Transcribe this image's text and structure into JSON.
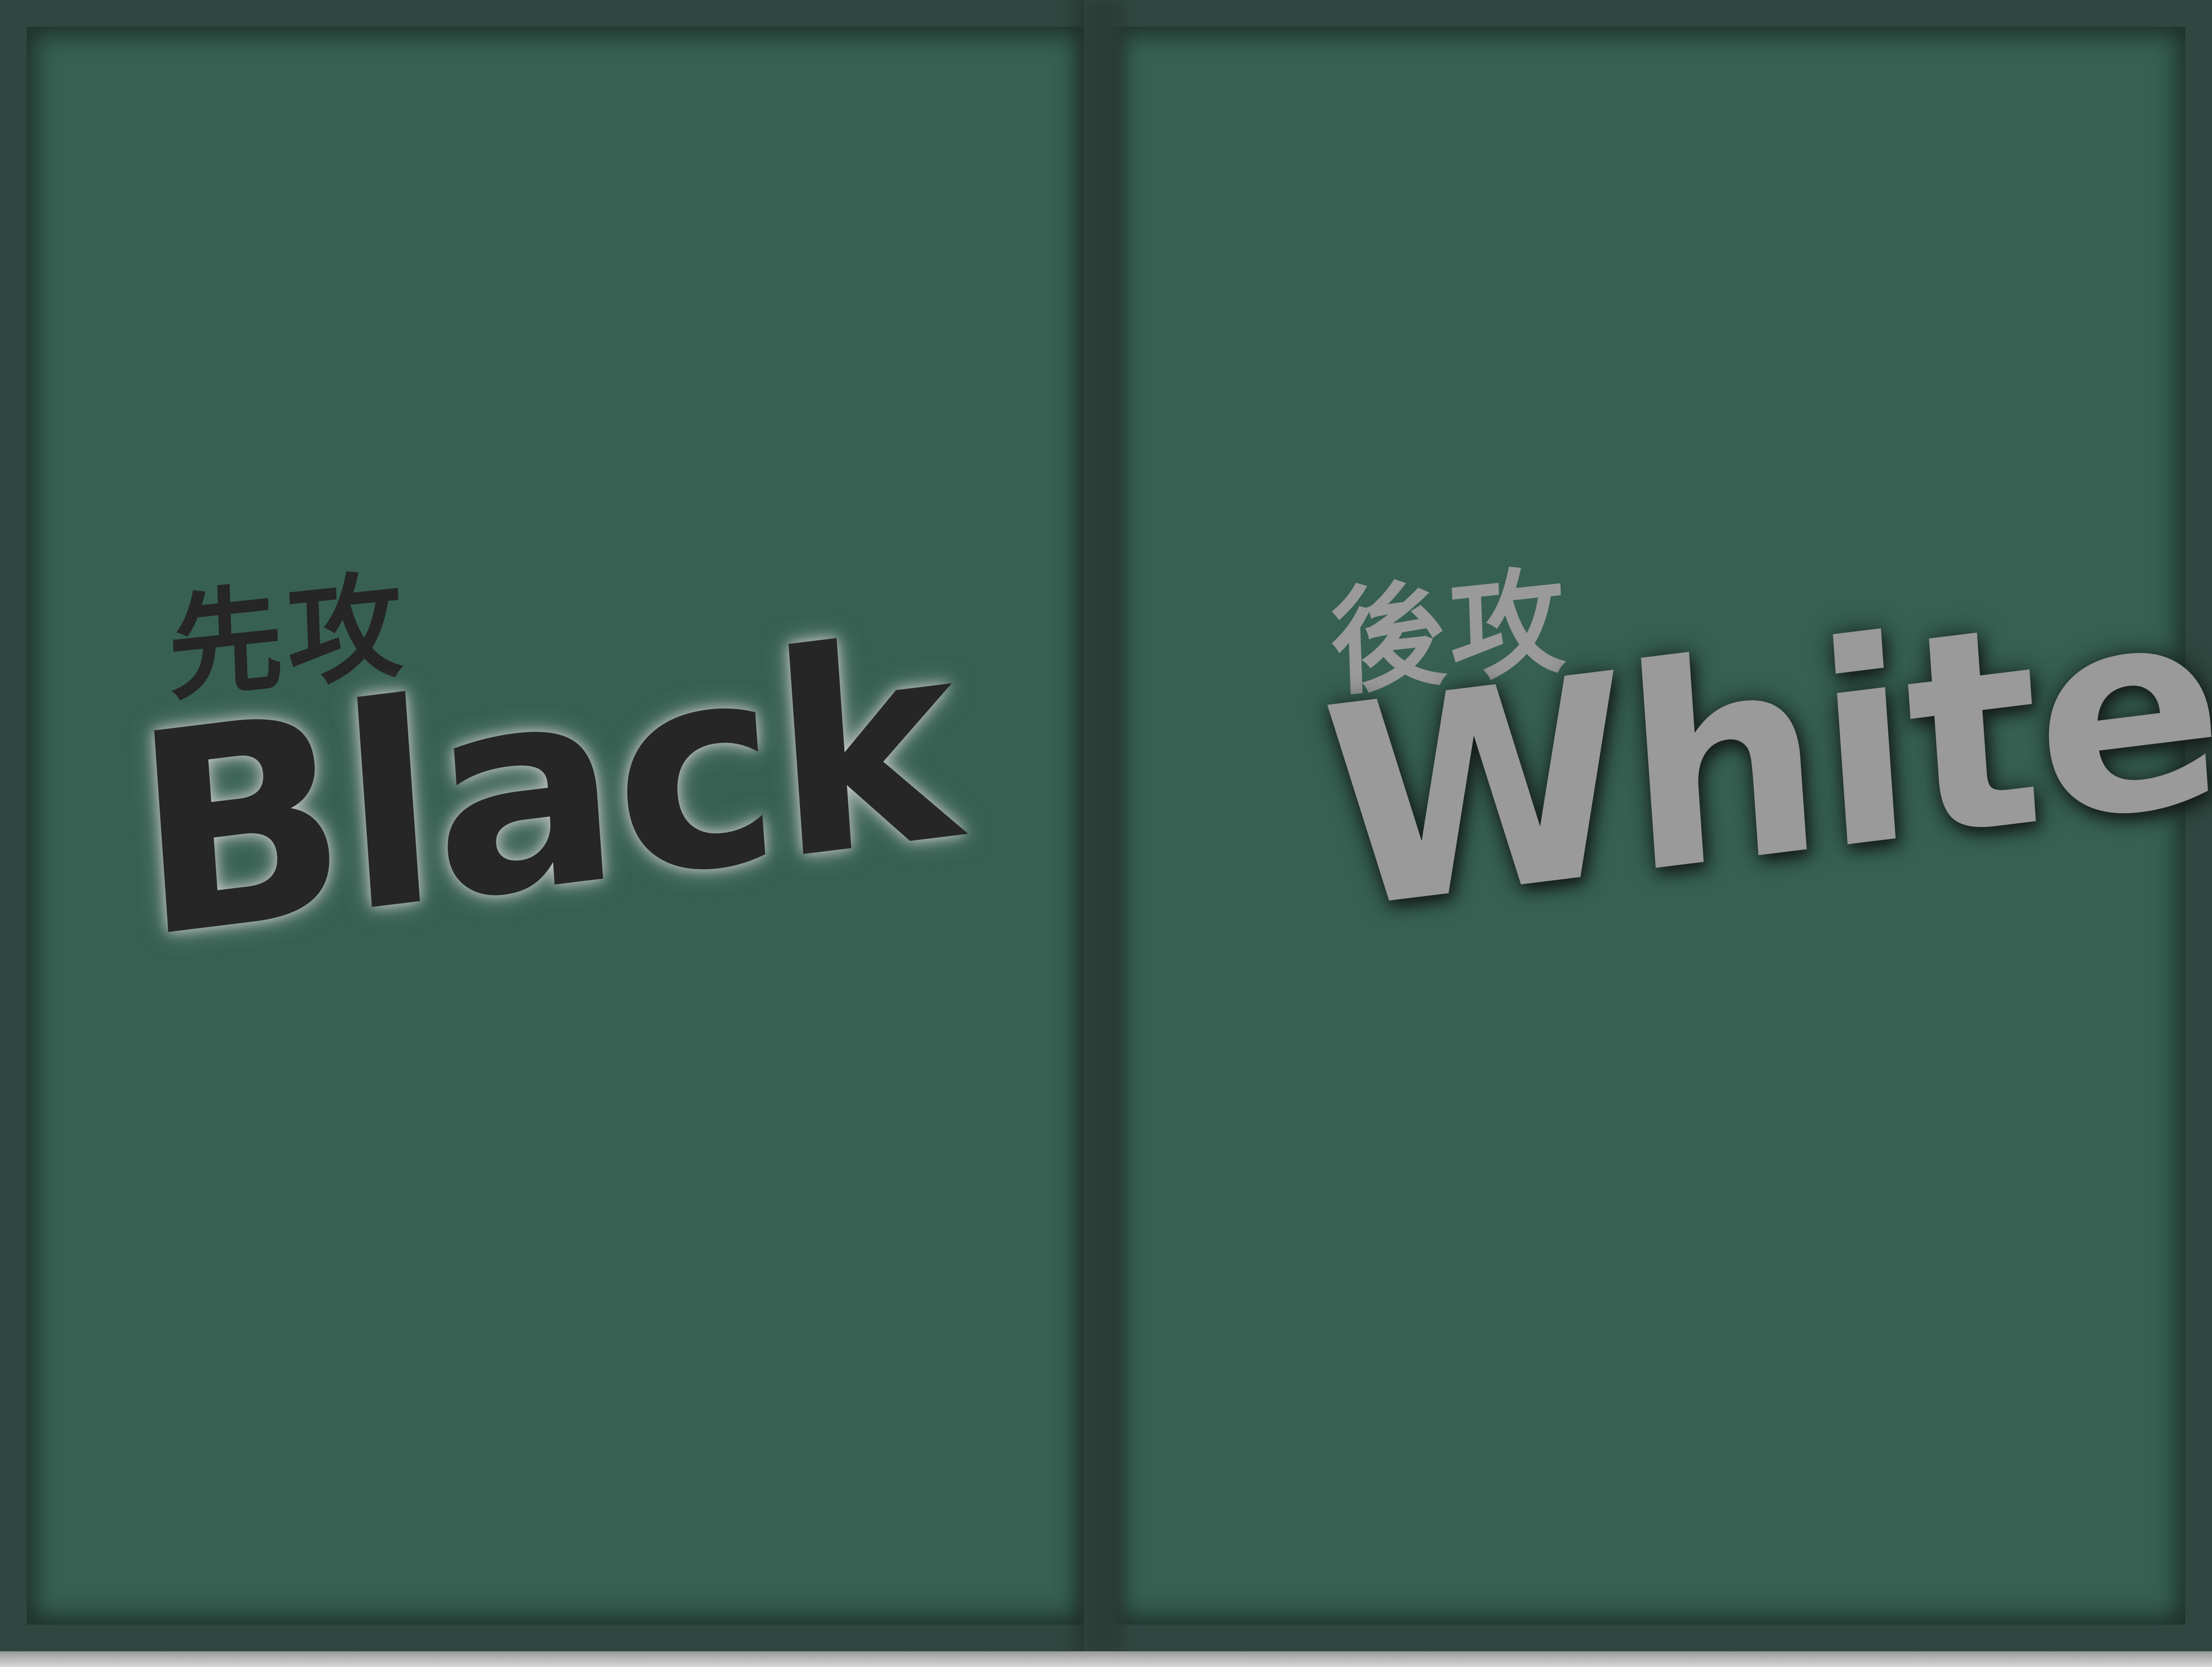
{
  "panels": {
    "first": {
      "kanji": "先攻",
      "word": "Black",
      "text_color": "#262626"
    },
    "second": {
      "kanji": "後攻",
      "word": "White",
      "text_color": "#999a99"
    }
  },
  "colors": {
    "felt": "#376052",
    "frame": "#2f4740",
    "background": "#cdcdcd"
  }
}
